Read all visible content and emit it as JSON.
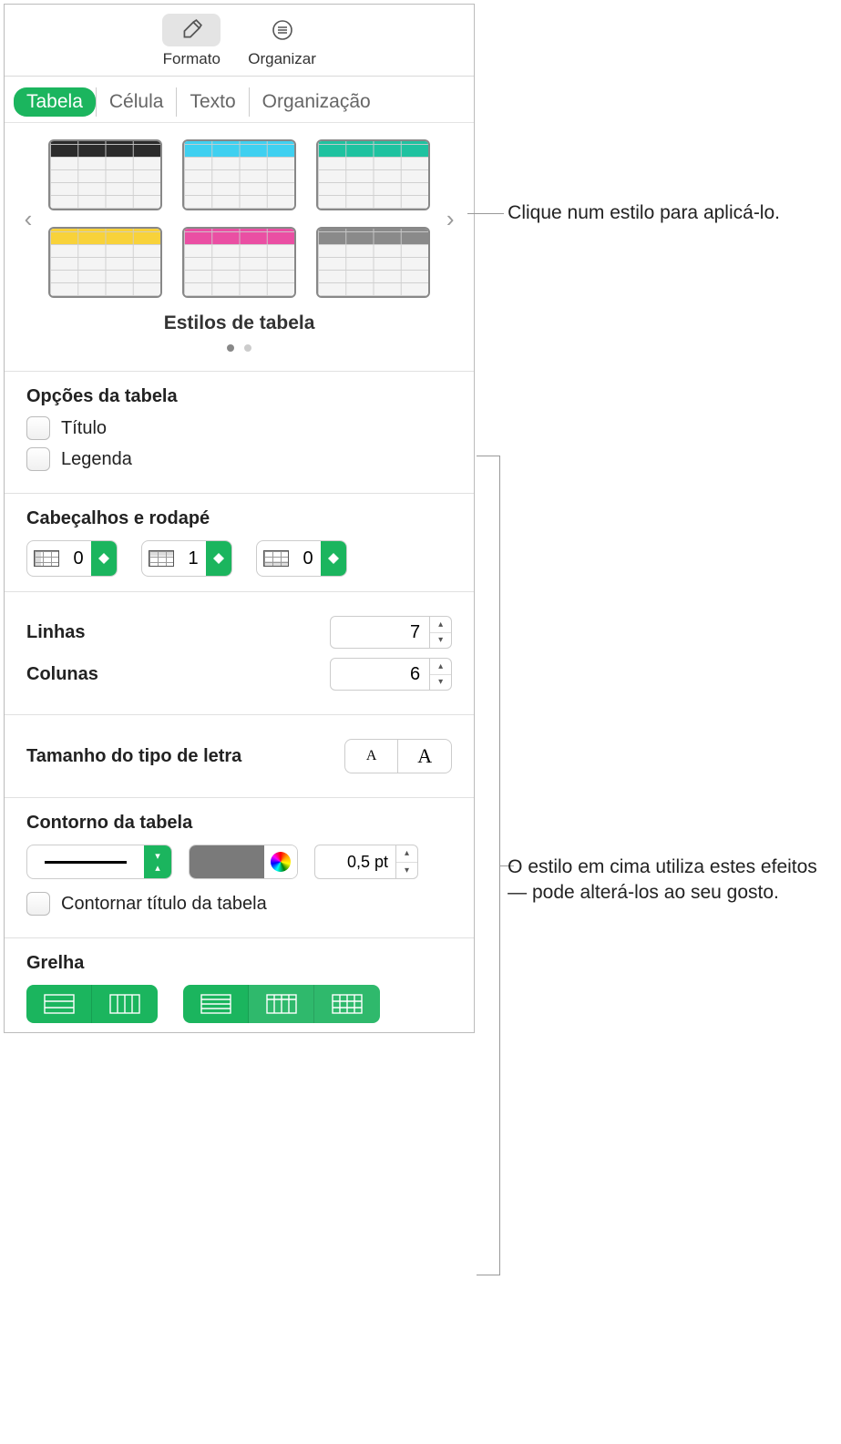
{
  "toolbar": {
    "format": "Formato",
    "organize": "Organizar"
  },
  "tabs": {
    "table": "Tabela",
    "cell": "Célula",
    "text": "Texto",
    "layout": "Organização"
  },
  "styles": {
    "caption": "Estilos de tabela",
    "thumbs": [
      {
        "color": "black"
      },
      {
        "color": "cyan"
      },
      {
        "color": "teal"
      },
      {
        "color": "yellow"
      },
      {
        "color": "pink"
      },
      {
        "color": "gray"
      }
    ]
  },
  "options": {
    "title": "Opções da tabela",
    "cb_title": "Título",
    "cb_caption": "Legenda"
  },
  "headers": {
    "title": "Cabeçalhos e rodapé",
    "cols": "0",
    "rows": "1",
    "footer": "0"
  },
  "dims": {
    "rows_label": "Linhas",
    "rows_value": "7",
    "cols_label": "Colunas",
    "cols_value": "6"
  },
  "font": {
    "label": "Tamanho do tipo de letra",
    "small": "A",
    "large": "A"
  },
  "outline": {
    "title": "Contorno da tabela",
    "width": "0,5 pt",
    "color": "#7a7a7a",
    "cb_outline_title": "Contornar título da tabela"
  },
  "grid": {
    "title": "Grelha"
  },
  "callouts": {
    "c1": "Clique num estilo para aplicá-lo.",
    "c2": "O estilo em cima utiliza estes efeitos — pode alterá-los ao seu gosto."
  }
}
